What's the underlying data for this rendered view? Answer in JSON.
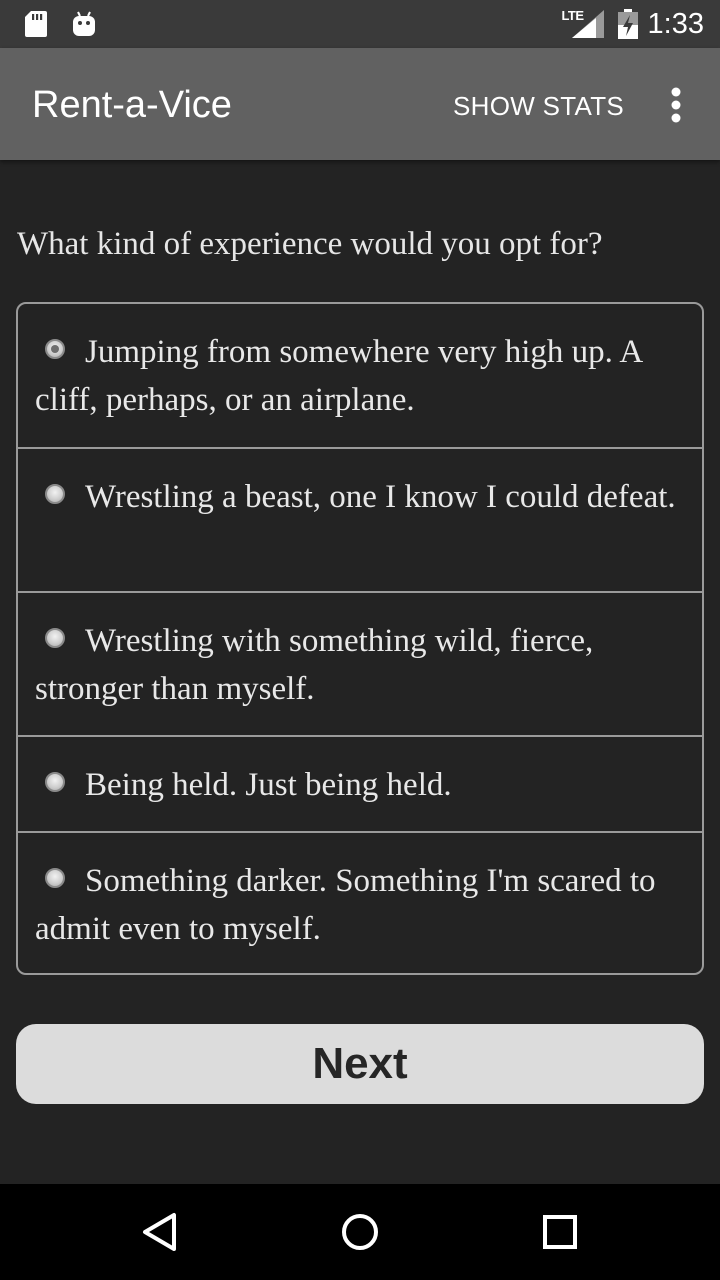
{
  "status_bar": {
    "time": "1:33",
    "network": "LTE",
    "icons": [
      "sd-card-icon",
      "android-debug-icon",
      "signal-icon",
      "battery-charging-icon"
    ]
  },
  "app_bar": {
    "title": "Rent-a-Vice",
    "show_stats_label": "SHOW STATS",
    "overflow_icon": "more-vert-icon"
  },
  "question": "What kind of experience would you opt for?",
  "options": [
    {
      "label": "Jumping from somewhere very high up. A cliff, perhaps, or an airplane.",
      "selected": true
    },
    {
      "label": "Wrestling a beast, one I know I could defeat.",
      "selected": false
    },
    {
      "label": "Wrestling with something wild, fierce, stronger than myself.",
      "selected": false
    },
    {
      "label": "Being held. Just being held.",
      "selected": false
    },
    {
      "label": "Something darker. Something I'm scared to admit even to myself.",
      "selected": false
    }
  ],
  "next_label": "Next",
  "nav_bar": {
    "icons": [
      "back-icon",
      "home-icon",
      "recents-icon"
    ]
  }
}
